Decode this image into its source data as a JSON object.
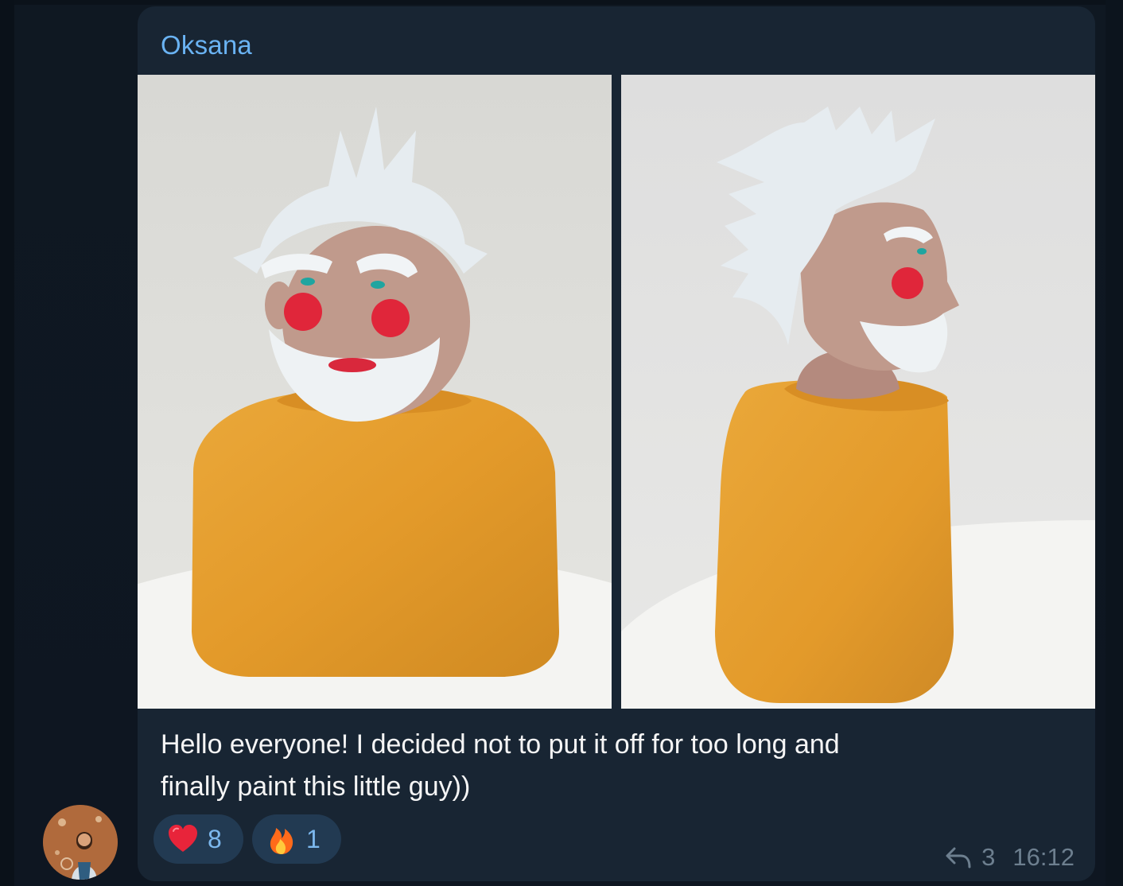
{
  "message": {
    "sender": "Oksana",
    "caption_line1": "Hello everyone! I decided not to put it off for too long and",
    "caption_line2": "finally paint this little guy))",
    "photos": [
      {
        "subject": "ceramic-bust-front",
        "hair_color": "#e8eef2",
        "sweater_color": "#e39a2a"
      },
      {
        "subject": "ceramic-bust-side",
        "hair_color": "#e8eef2",
        "sweater_color": "#e39a2a"
      }
    ],
    "reactions": [
      {
        "emoji": "heart-emoji-icon",
        "count": "8"
      },
      {
        "emoji": "fire-emoji-icon",
        "count": "1"
      }
    ],
    "replies_count": "3",
    "time": "16:12"
  },
  "colors": {
    "background": "#0e1621",
    "bubble": "#182533",
    "sender_name": "#6ab3f3",
    "reaction_bg": "#223a52",
    "reaction_count": "#7cb8ee",
    "meta": "#6d7f8f"
  }
}
